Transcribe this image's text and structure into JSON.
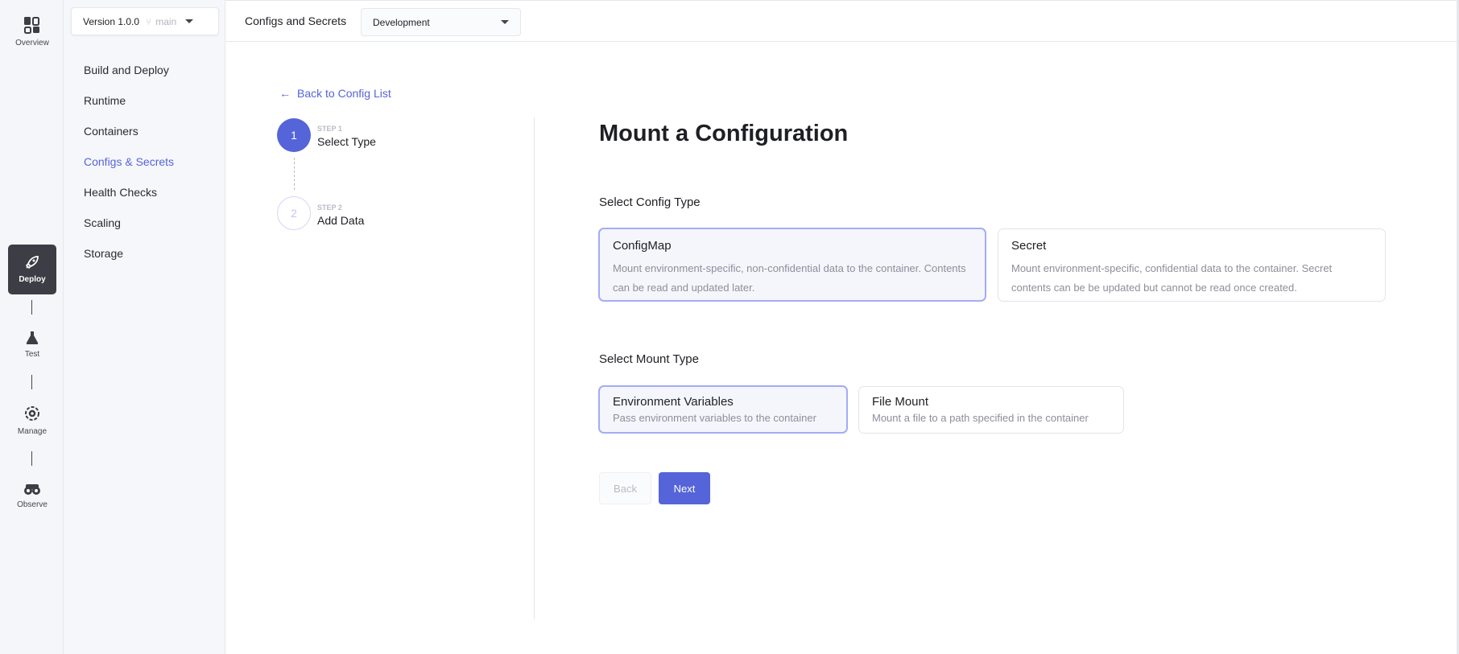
{
  "rail": {
    "items": [
      {
        "label": "Overview",
        "icon": "overview-icon"
      },
      {
        "label": "Deploy",
        "icon": "rocket-icon"
      },
      {
        "label": "Test",
        "icon": "flask-icon"
      },
      {
        "label": "Manage",
        "icon": "gear-icon"
      },
      {
        "label": "Observe",
        "icon": "binoculars-icon"
      }
    ]
  },
  "sidebar": {
    "version": "Version 1.0.0",
    "branch": "main",
    "items": [
      {
        "label": "Build and Deploy"
      },
      {
        "label": "Runtime"
      },
      {
        "label": "Containers"
      },
      {
        "label": "Configs & Secrets",
        "active": true
      },
      {
        "label": "Health Checks"
      },
      {
        "label": "Scaling"
      },
      {
        "label": "Storage"
      }
    ]
  },
  "header": {
    "title": "Configs and Secrets",
    "environment": "Development"
  },
  "main": {
    "back_link": "Back to Config List",
    "steps": [
      {
        "number": "1",
        "label": "STEP 1",
        "title": "Select Type",
        "active": true
      },
      {
        "number": "2",
        "label": "STEP 2",
        "title": "Add Data",
        "active": false
      }
    ],
    "title": "Mount a Configuration",
    "config_type": {
      "label": "Select Config Type",
      "options": [
        {
          "title": "ConfigMap",
          "desc": "Mount environment-specific, non-confidential data to the container. Contents can be read and updated later.",
          "selected": true
        },
        {
          "title": "Secret",
          "desc": "Mount environment-specific, confidential data to the container. Secret contents can be be updated but cannot be read once created.",
          "selected": false
        }
      ]
    },
    "mount_type": {
      "label": "Select Mount Type",
      "options": [
        {
          "title": "Environment Variables",
          "desc": "Pass environment variables to the container",
          "selected": true
        },
        {
          "title": "File Mount",
          "desc": "Mount a file to a path specified in the container",
          "selected": false
        }
      ]
    },
    "back_button": "Back",
    "next_button": "Next"
  },
  "colors": {
    "accent": "#5564d8",
    "selected_border": "#a3acf5",
    "rail_active": "#3c3d45"
  }
}
